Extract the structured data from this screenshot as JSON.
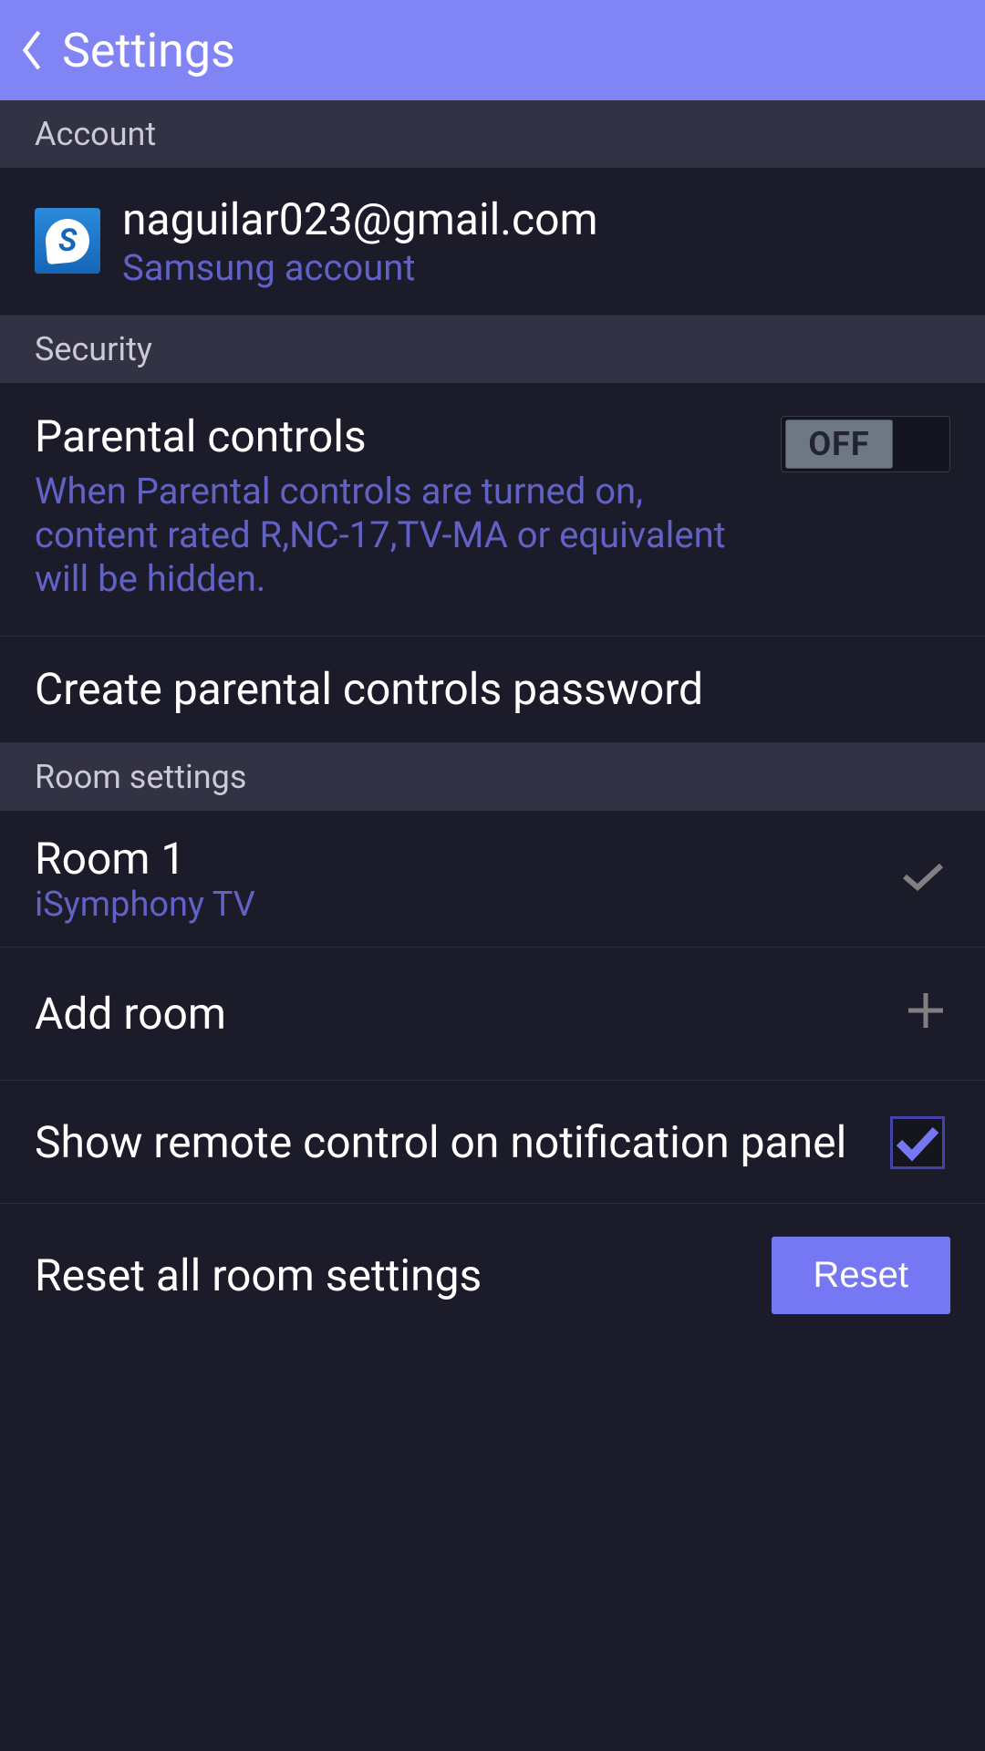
{
  "header": {
    "title": "Settings"
  },
  "sections": {
    "account": {
      "header": "Account",
      "email": "naguilar023@gmail.com",
      "subtitle": "Samsung account",
      "icon_letter": "S"
    },
    "security": {
      "header": "Security",
      "parental": {
        "title": "Parental controls",
        "description": "When Parental controls are turned on, content rated R,NC-17,TV-MA or equivalent will be hidden.",
        "toggle_state": "OFF"
      },
      "create_password": "Create parental controls password"
    },
    "rooms": {
      "header": "Room settings",
      "room1": {
        "title": "Room 1",
        "subtitle": "iSymphony TV"
      },
      "add_room": "Add room",
      "show_remote": "Show remote control on notification panel",
      "reset": {
        "title": "Reset all room settings",
        "button": "Reset"
      }
    }
  }
}
